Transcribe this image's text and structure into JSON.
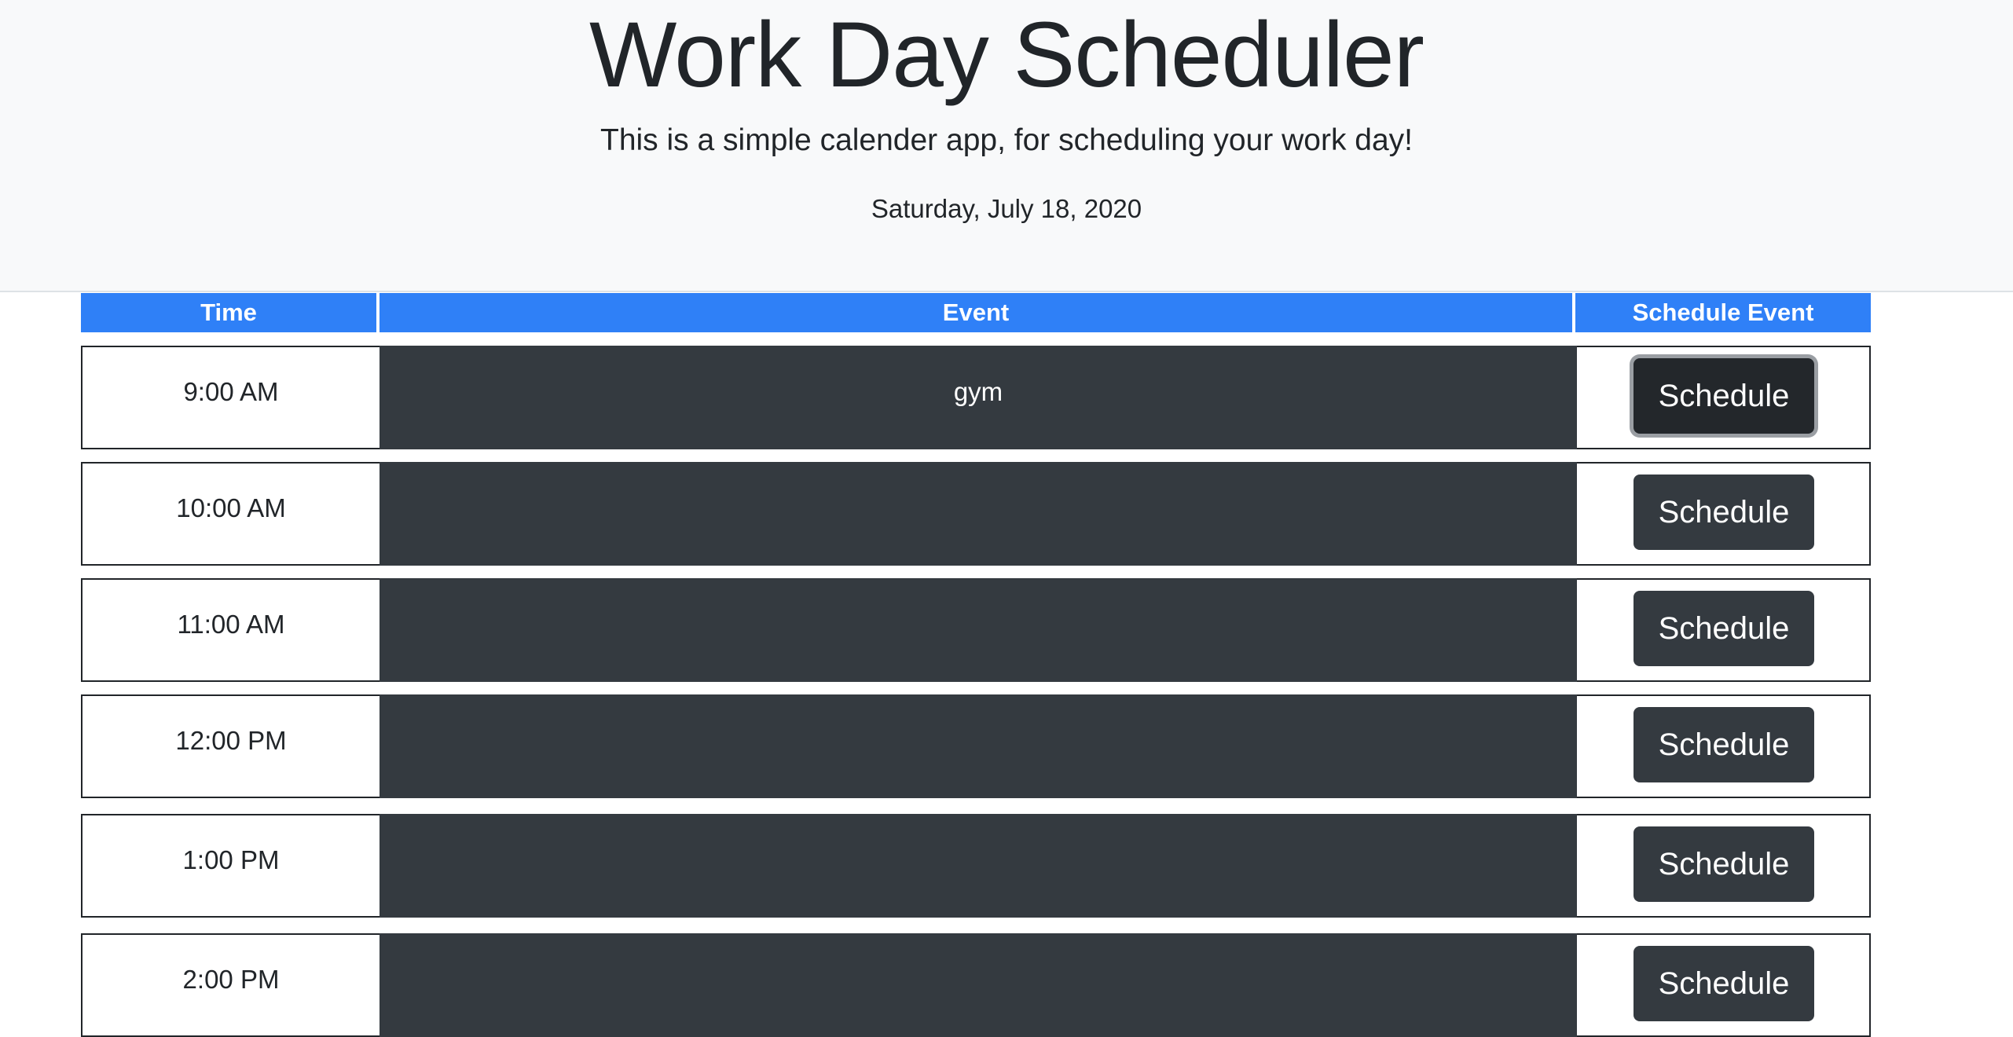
{
  "header": {
    "title": "Work Day Scheduler",
    "subtitle": "This is a simple calender app, for scheduling your work day!",
    "current_date": "Saturday, July 18, 2020"
  },
  "table": {
    "columns": [
      "Time",
      "Event",
      "Schedule Event"
    ],
    "rows": [
      {
        "time": "9:00 AM",
        "event": "gym",
        "button": "Schedule"
      },
      {
        "time": "10:00 AM",
        "event": "",
        "button": "Schedule"
      },
      {
        "time": "11:00 AM",
        "event": "",
        "button": "Schedule"
      },
      {
        "time": "12:00 PM",
        "event": "",
        "button": "Schedule"
      },
      {
        "time": "1:00 PM",
        "event": "",
        "button": "Schedule"
      },
      {
        "time": "2:00 PM",
        "event": "",
        "button": "Schedule"
      }
    ]
  },
  "colors": {
    "header_bg": "#2f80f7",
    "event_bg": "#343a40",
    "button_bg": "#343a40"
  }
}
